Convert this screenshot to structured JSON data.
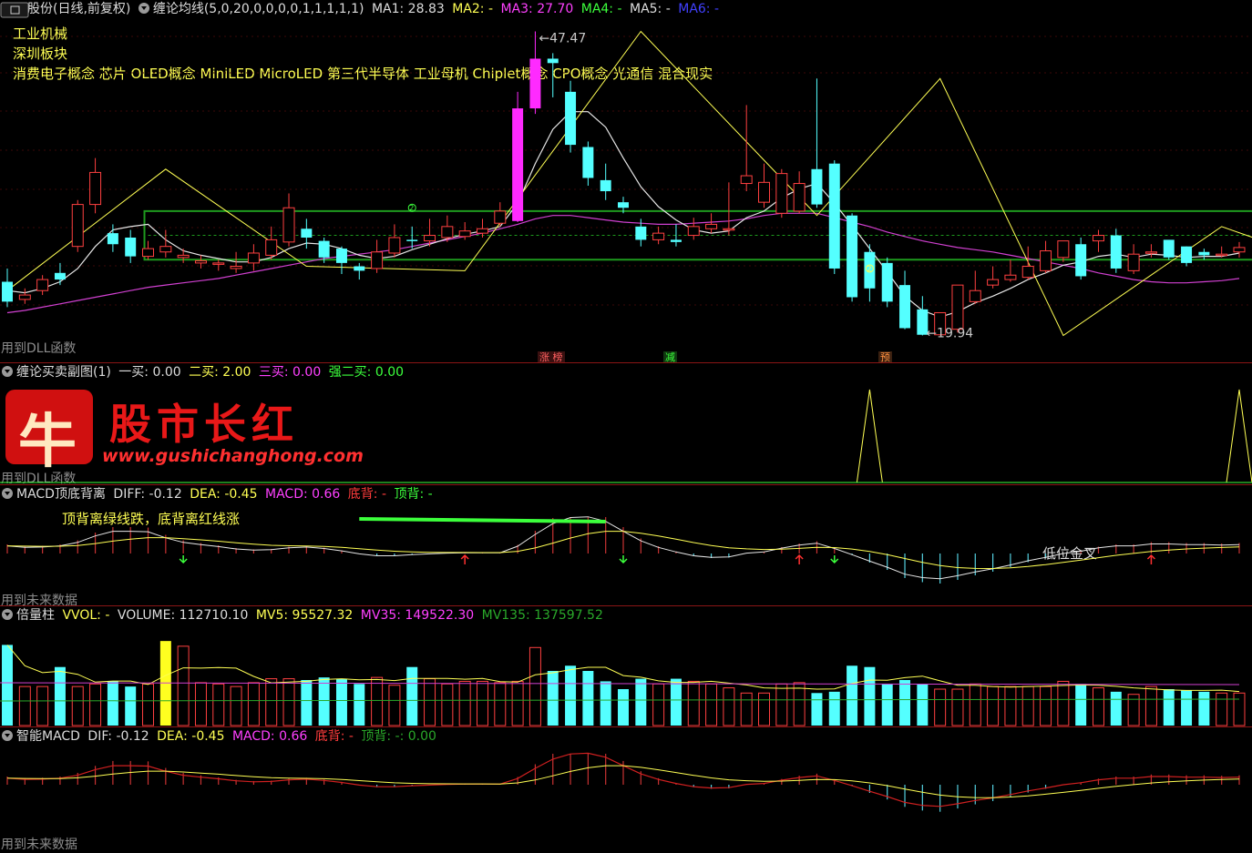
{
  "main_pane": {
    "stock": "易天股份(日线,前复权)",
    "indicator": "缠论均线(5,0,20,0,0,0,0,1,1,1,1,1)",
    "ma": [
      {
        "label": "MA1: 28.83",
        "color": "#dcdcdc"
      },
      {
        "label": "MA2: -",
        "color": "#ffff54"
      },
      {
        "label": "MA3: 27.70",
        "color": "#ff40ff"
      },
      {
        "label": "MA4: -",
        "color": "#3cff3c"
      },
      {
        "label": "MA5: -",
        "color": "#dcdcdc"
      },
      {
        "label": "MA6: -",
        "color": "#4040ff"
      }
    ],
    "concepts": [
      "工业机械",
      "深圳板块",
      "消费电子概念 芯片 OLED概念 MiniLED MicroLED 第三代半导体 工业母机 Chiplet概念 CPO概念 光通信 混合现实"
    ],
    "high_label": "47.47",
    "low_label": "19.94",
    "footer": "用到DLL函数",
    "events": [
      {
        "label": "涨 榜",
        "color": "#ff6060"
      },
      {
        "label": "减",
        "color": "#3cff3c"
      },
      {
        "label": "预",
        "color": "#ff9040"
      }
    ],
    "zs_markers": [
      "②",
      "②",
      "②"
    ]
  },
  "pane2": {
    "title": "缠论买卖副图(1)",
    "items": [
      {
        "label": "一买: 0.00",
        "color": "#dcdcdc"
      },
      {
        "label": "二买: 2.00",
        "color": "#ffff54"
      },
      {
        "label": "三买: 0.00",
        "color": "#ff40ff"
      },
      {
        "label": "强二买: 0.00",
        "color": "#3cff3c"
      }
    ],
    "footer": "用到DLL函数"
  },
  "pane3": {
    "title": "MACD顶底背离",
    "items": [
      {
        "label": "DIFF: -0.12",
        "color": "#dcdcdc"
      },
      {
        "label": "DEA: -0.45",
        "color": "#ffff54"
      },
      {
        "label": "MACD: 0.66",
        "color": "#ff40ff"
      },
      {
        "label": "底背: -",
        "color": "#ff3c3c"
      },
      {
        "label": "顶背: -",
        "color": "#3cff3c"
      }
    ],
    "note": "顶背离绿线跌，底背离红线涨",
    "golden_cross": "低位金叉",
    "footer": "用到未来数据"
  },
  "pane4": {
    "title": "倍量柱",
    "items": [
      {
        "label": "VVOL: -",
        "color": "#ffff54"
      },
      {
        "label": "VOLUME: 112710.10",
        "color": "#dcdcdc"
      },
      {
        "label": "MV5: 95527.32",
        "color": "#ffff54"
      },
      {
        "label": "MV35: 149522.30",
        "color": "#ff40ff"
      },
      {
        "label": "MV135: 137597.52",
        "color": "#2aa82a"
      }
    ]
  },
  "pane5": {
    "title": "智能MACD",
    "items": [
      {
        "label": "DIF: -0.12",
        "color": "#dcdcdc"
      },
      {
        "label": "DEA: -0.45",
        "color": "#ffff54"
      },
      {
        "label": "MACD: 0.66",
        "color": "#ff40ff"
      },
      {
        "label": "底背: -",
        "color": "#ff3c3c"
      },
      {
        "label": "顶背: -",
        "color": "#2aa82a"
      },
      {
        "label": ": 0.00",
        "color": "#2aa82a"
      }
    ],
    "footer": "用到未来数据"
  },
  "watermark": {
    "glyph": "牛",
    "name": "股市长红",
    "url": "www.gushichanghong.com"
  },
  "chart_data": {
    "type": "candlestick",
    "ohlc_open": [
      24.8,
      23.2,
      24.0,
      25.6,
      28.0,
      31.8,
      29.2,
      28.8,
      27.1,
      27.5,
      27.0,
      26.5,
      26.4,
      26.0,
      26.5,
      27.2,
      28.4,
      29.6,
      28.5,
      27.8,
      26.2,
      26.0,
      27.4,
      28.6,
      28.5,
      28.8,
      28.9,
      29.2,
      30.1,
      30.3,
      40.5,
      45.0,
      42.0,
      37.0,
      34.0,
      32.0,
      29.8,
      28.6,
      28.6,
      29.0,
      29.6,
      29.5,
      33.7,
      32.0,
      31.0,
      31.2,
      35.0,
      35.5,
      30.8,
      27.5,
      26.5,
      24.5,
      22.3,
      20.0,
      20.5,
      23.0,
      24.5,
      25.0,
      25.2,
      25.8,
      27.0,
      28.2,
      28.5,
      29.0,
      25.8,
      27.5,
      28.6,
      28.0,
      27.5,
      27.3,
      27.5
    ],
    "ohlc_close": [
      23.0,
      23.6,
      25.0,
      25.0,
      31.8,
      34.7,
      28.2,
      27.1,
      27.8,
      28.0,
      27.2,
      26.7,
      26.5,
      26.2,
      27.4,
      28.6,
      31.5,
      28.8,
      27.0,
      26.5,
      25.8,
      27.5,
      28.8,
      28.5,
      29.0,
      29.8,
      29.4,
      29.6,
      31.2,
      40.5,
      45.0,
      44.6,
      37.2,
      34.2,
      33.0,
      31.5,
      28.6,
      29.2,
      28.4,
      29.8,
      30.0,
      29.6,
      34.4,
      33.8,
      34.6,
      33.7,
      31.8,
      26.0,
      23.4,
      24.2,
      23.0,
      20.6,
      20.0,
      22.0,
      24.5,
      24.0,
      25.0,
      25.4,
      26.2,
      27.6,
      28.5,
      25.3,
      29.0,
      26.0,
      27.3,
      27.5,
      27.0,
      26.5,
      27.2,
      27.3,
      27.9
    ],
    "ohlc_high": [
      26.0,
      24.2,
      25.4,
      26.5,
      32.2,
      36.0,
      30.0,
      29.5,
      28.5,
      29.5,
      27.8,
      27.2,
      26.8,
      27.5,
      28.2,
      29.8,
      32.8,
      30.5,
      28.8,
      28.0,
      26.5,
      28.6,
      30.0,
      29.8,
      30.5,
      30.8,
      30.2,
      30.5,
      32.0,
      42.0,
      47.47,
      45.5,
      43.0,
      37.5,
      35.5,
      32.5,
      30.5,
      29.8,
      30.0,
      30.6,
      31.0,
      33.8,
      40.8,
      35.5,
      35.0,
      34.8,
      43.2,
      35.8,
      31.0,
      28.2,
      27.0,
      25.8,
      23.5,
      20.8,
      23.0,
      25.8,
      26.2,
      26.8,
      28.0,
      28.5,
      28.5,
      28.8,
      29.5,
      29.6,
      28.2,
      28.2,
      28.0,
      28.0,
      27.8,
      28.0,
      28.4
    ],
    "ohlc_low": [
      22.5,
      22.8,
      23.6,
      24.5,
      27.5,
      31.0,
      27.5,
      26.5,
      26.8,
      27.0,
      26.5,
      26.0,
      25.8,
      25.6,
      25.8,
      26.8,
      28.0,
      27.8,
      26.5,
      25.5,
      25.0,
      25.6,
      27.0,
      27.8,
      28.0,
      28.4,
      28.6,
      28.8,
      29.8,
      30.2,
      40.0,
      41.5,
      36.5,
      33.5,
      32.2,
      31.0,
      28.0,
      28.2,
      28.0,
      28.6,
      29.2,
      29.0,
      33.0,
      31.5,
      30.6,
      31.0,
      31.5,
      25.5,
      23.0,
      23.0,
      22.5,
      20.5,
      19.94,
      19.94,
      20.2,
      22.8,
      24.2,
      24.8,
      25.0,
      25.6,
      26.6,
      25.0,
      27.5,
      25.6,
      25.5,
      27.0,
      26.8,
      26.2,
      26.8,
      27.0,
      27.0
    ],
    "ma20": [
      22.0,
      22.2,
      22.5,
      22.8,
      23.1,
      23.4,
      23.7,
      24.0,
      24.3,
      24.5,
      24.7,
      24.9,
      25.1,
      25.4,
      25.7,
      26.0,
      26.3,
      26.6,
      26.9,
      27.1,
      27.3,
      27.5,
      27.7,
      28.0,
      28.3,
      28.6,
      28.9,
      29.2,
      29.6,
      30.0,
      30.5,
      30.8,
      30.8,
      30.6,
      30.4,
      30.2,
      30.1,
      30.0,
      30.0,
      30.1,
      30.2,
      30.3,
      30.5,
      30.8,
      31.0,
      31.0,
      31.0,
      30.6,
      30.2,
      29.8,
      29.3,
      28.9,
      28.5,
      28.2,
      27.9,
      27.7,
      27.5,
      27.2,
      26.9,
      26.6,
      26.3,
      26.0,
      25.6,
      25.3,
      25.0,
      24.8,
      24.7,
      24.7,
      24.8,
      24.9,
      25.1
    ],
    "ma5": [
      24.0,
      23.8,
      24.2,
      24.8,
      26.0,
      28.0,
      29.5,
      29.8,
      30.0,
      28.6,
      27.6,
      27.2,
      26.9,
      26.6,
      26.6,
      27.0,
      27.8,
      28.3,
      28.2,
      27.8,
      27.2,
      26.9,
      27.1,
      27.7,
      28.2,
      28.7,
      29.1,
      29.4,
      29.8,
      31.9,
      35.5,
      38.6,
      40.2,
      40.2,
      38.8,
      36.0,
      33.4,
      31.6,
      30.4,
      29.5,
      29.2,
      29.4,
      30.6,
      31.2,
      32.4,
      33.2,
      33.7,
      31.9,
      29.9,
      27.8,
      25.7,
      23.5,
      22.2,
      21.6,
      22.1,
      22.9,
      23.5,
      24.2,
      25.0,
      25.6,
      26.3,
      26.6,
      27.1,
      27.3,
      27.0,
      27.3,
      27.2,
      27.0,
      27.1,
      27.1,
      27.4
    ],
    "bi_points": [
      [
        0,
        24.0
      ],
      [
        9,
        35.0
      ],
      [
        17,
        26.2
      ],
      [
        26,
        25.8
      ],
      [
        36,
        47.47
      ],
      [
        46,
        30.8
      ],
      [
        53,
        43.2
      ],
      [
        60,
        19.94
      ],
      [
        69,
        29.8
      ],
      [
        74,
        27.0
      ]
    ],
    "zs_box": {
      "top": 31.2,
      "bottom": 26.8,
      "start": 8,
      "end": 75
    },
    "zs_mid": 29.0,
    "y_range": [
      18.0,
      48.5
    ],
    "volume": [
      6.2,
      3.0,
      3.0,
      4.5,
      3.0,
      3.2,
      3.4,
      3.0,
      3.2,
      6.5,
      6.1,
      3.3,
      3.2,
      3.0,
      3.3,
      3.6,
      3.6,
      3.5,
      3.7,
      3.6,
      3.2,
      3.7,
      3.1,
      4.5,
      3.6,
      3.2,
      3.4,
      3.4,
      3.3,
      3.4,
      6.0,
      4.2,
      4.6,
      4.2,
      3.4,
      2.8,
      3.6,
      3.2,
      3.6,
      3.4,
      3.2,
      2.9,
      2.5,
      2.5,
      3.2,
      3.3,
      2.5,
      2.6,
      4.6,
      4.5,
      3.2,
      3.5,
      3.2,
      2.8,
      2.8,
      3.2,
      3.0,
      3.0,
      3.0,
      3.0,
      3.4,
      3.2,
      2.9,
      2.6,
      2.4,
      3.0,
      2.8,
      2.7,
      2.6,
      2.5,
      2.5
    ]
  }
}
